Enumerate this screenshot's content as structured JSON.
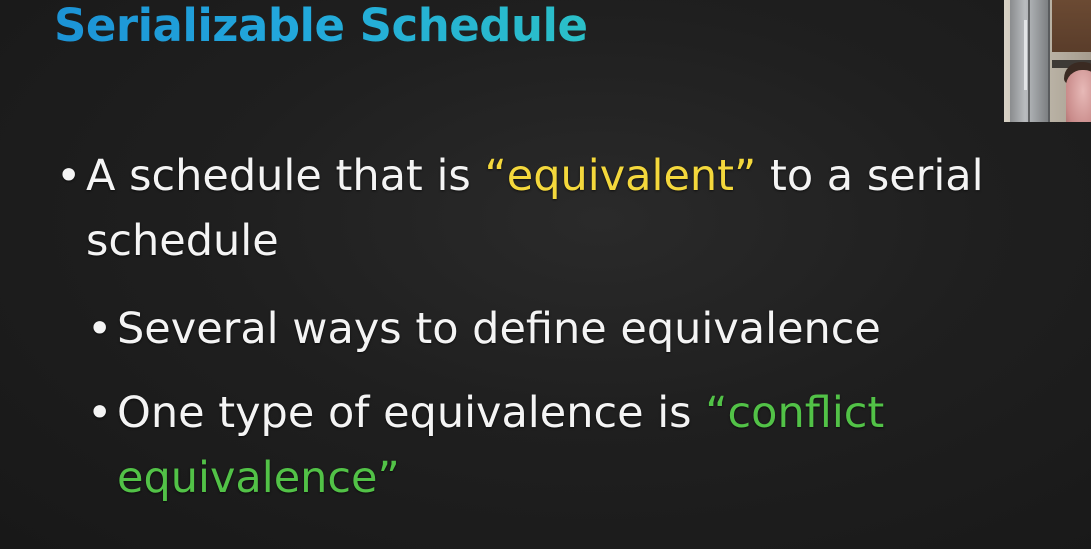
{
  "slide": {
    "title": "Serializable Schedule",
    "bullet_char": "•",
    "bullets": [
      {
        "level": 1,
        "parts": [
          {
            "text": "A schedule that is "
          },
          {
            "text": "“equivalent”",
            "color": "#f4d83c"
          },
          {
            "text": " to a serial schedule"
          }
        ]
      },
      {
        "level": 2,
        "parts": [
          {
            "text": "Several ways to define equivalence"
          }
        ]
      },
      {
        "level": 2,
        "parts": [
          {
            "text": "One type of equivalence is "
          },
          {
            "text": "“conflict equivalence”",
            "color": "#52c247"
          }
        ]
      }
    ]
  },
  "colors": {
    "background": "#1f1f1f",
    "title_gradient_start": "#1c93d6",
    "title_gradient_end": "#2bc0c8",
    "body_text": "#f4f4f4",
    "highlight_yellow": "#f4d83c",
    "highlight_green": "#52c247"
  },
  "overlay": {
    "icon": "webcam-video-icon"
  }
}
